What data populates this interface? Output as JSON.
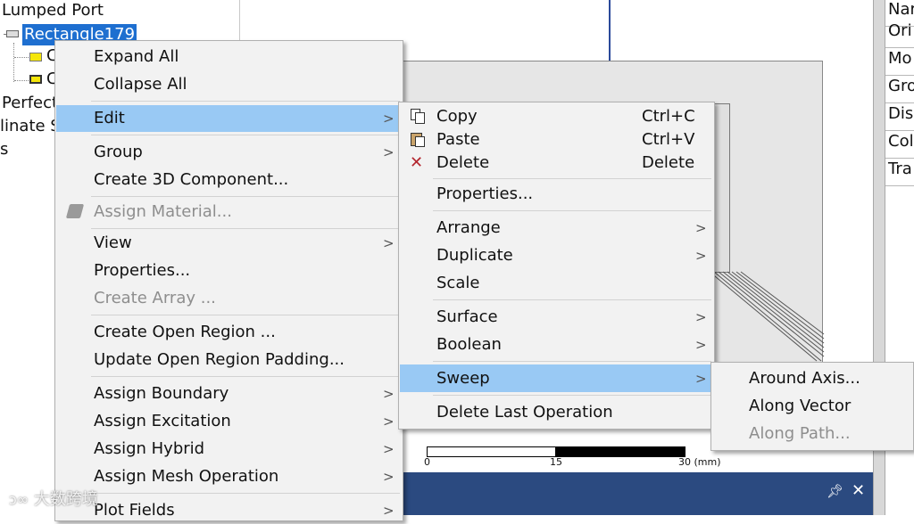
{
  "tree": {
    "items": [
      {
        "label": "Lumped Port"
      },
      {
        "label": "Rectangle179",
        "selected": true
      },
      {
        "label": "C"
      },
      {
        "label": "C"
      },
      {
        "label": "Perfect"
      },
      {
        "label": "linate S"
      },
      {
        "label": "s"
      }
    ]
  },
  "properties_panel": {
    "rows": [
      "Nar",
      "Ori",
      "Mo",
      "Gro",
      "Dis",
      "Col",
      "Tra"
    ]
  },
  "view": {
    "scale_bar": {
      "ticks": [
        "0",
        "15",
        "30 (mm)"
      ]
    }
  },
  "bottom_bar": {
    "pin_icon": "pin-icon",
    "close_icon": "close-icon"
  },
  "watermark": {
    "text": "大数跨境"
  },
  "context_menu": {
    "items": [
      {
        "label": "Expand All"
      },
      {
        "label": "Collapse All"
      },
      {
        "label": "Edit",
        "submenu": true,
        "highlighted": true
      },
      {
        "label": "Group",
        "submenu": true
      },
      {
        "label": "Create 3D Component..."
      },
      {
        "label": "Assign Material...",
        "disabled": true,
        "icon": "material-icon"
      },
      {
        "label": "View",
        "submenu": true
      },
      {
        "label": "Properties..."
      },
      {
        "label": "Create Array ...",
        "disabled": true
      },
      {
        "label": "Create Open Region ..."
      },
      {
        "label": "Update Open Region Padding..."
      },
      {
        "label": "Assign Boundary",
        "submenu": true
      },
      {
        "label": "Assign Excitation",
        "submenu": true
      },
      {
        "label": "Assign Hybrid",
        "submenu": true
      },
      {
        "label": "Assign Mesh Operation",
        "submenu": true
      },
      {
        "label": "Plot Fields",
        "submenu": true
      }
    ]
  },
  "edit_submenu": {
    "items": [
      {
        "label": "Copy",
        "shortcut": "Ctrl+C",
        "icon": "copy-icon"
      },
      {
        "label": "Paste",
        "shortcut": "Ctrl+V",
        "icon": "paste-icon"
      },
      {
        "label": "Delete",
        "shortcut": "Delete",
        "icon": "delete-icon"
      },
      {
        "label": "Properties..."
      },
      {
        "label": "Arrange",
        "submenu": true
      },
      {
        "label": "Duplicate",
        "submenu": true
      },
      {
        "label": "Scale"
      },
      {
        "label": "Surface",
        "submenu": true
      },
      {
        "label": "Boolean",
        "submenu": true
      },
      {
        "label": "Sweep",
        "submenu": true,
        "highlighted": true
      },
      {
        "label": "Delete Last Operation"
      }
    ]
  },
  "sweep_submenu": {
    "items": [
      {
        "label": "Around Axis..."
      },
      {
        "label": "Along Vector"
      },
      {
        "label": "Along Path...",
        "disabled": true
      }
    ]
  },
  "colors": {
    "highlight": "#99c9f4",
    "selection": "#1e6fd0",
    "bottom_bar": "#2b4a80"
  }
}
